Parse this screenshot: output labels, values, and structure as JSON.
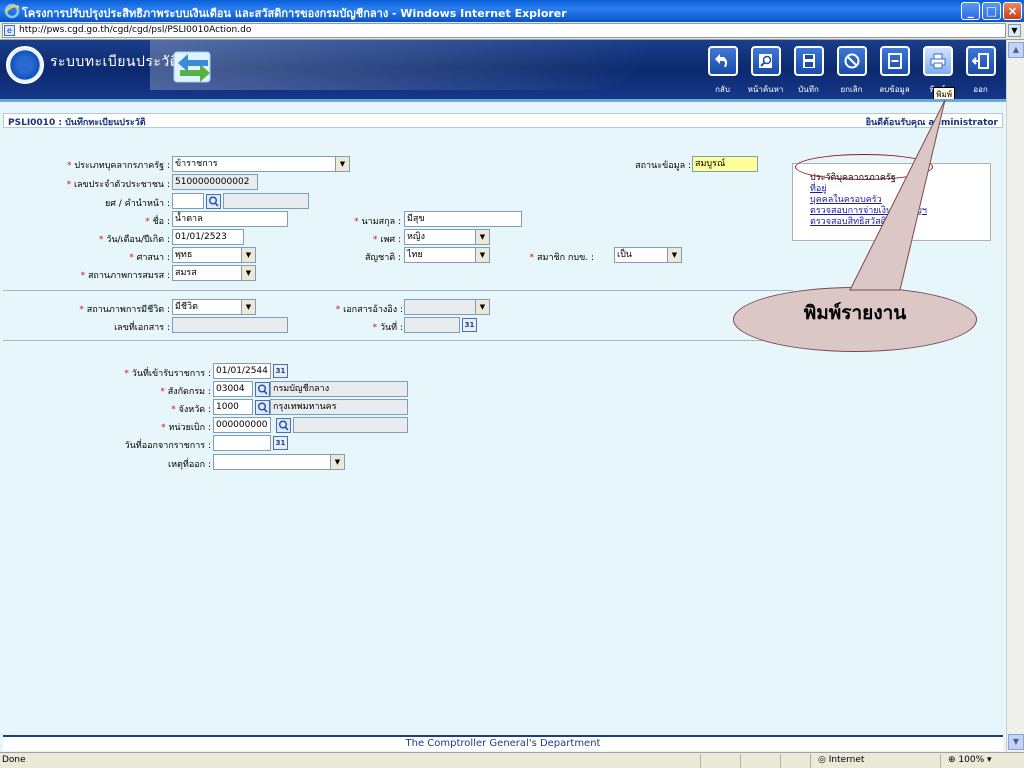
{
  "window": {
    "title": "โครงการปรับปรุงประสิทธิภาพระบบเงินเดือน และสวัสดิการของกรมบัญชีกลาง - Windows Internet Explorer",
    "url": "http://pws.cgd.go.th/cgd/cgd/psl/PSLI0010Action.do"
  },
  "app": {
    "title": "ระบบทะเบียนประวัติ",
    "toolbar": [
      {
        "id": "back",
        "label": "กลับ"
      },
      {
        "id": "search",
        "label": "หน้าค้นหา"
      },
      {
        "id": "save",
        "label": "บันทึก"
      },
      {
        "id": "cancel",
        "label": "ยกเลิก"
      },
      {
        "id": "delete",
        "label": "ลบข้อมูล"
      },
      {
        "id": "print",
        "label": "พิมพ์"
      },
      {
        "id": "exit",
        "label": "ออก"
      }
    ],
    "tooltip": "พิมพ์"
  },
  "section": {
    "code": "PSLI0010 : บันทึกทะเบียนประวัติ",
    "welcome": "ยินดีต้อนรับคุณ administrator"
  },
  "form": {
    "personnel_type_label": "ประเภทบุคลากรภาครัฐ :",
    "personnel_type": "ข้าราชการ",
    "citizen_id_label": "เลขประจำตัวประชาชน :",
    "citizen_id": "5100000000002",
    "rank_label": "ยศ / คำนำหน้า :",
    "rank": "",
    "first_name_label": "ชื่อ :",
    "first_name": "น้ำตาล",
    "last_name_label": "นามสกุล :",
    "last_name": "มีสุข",
    "birth_date_label": "วัน/เดือน/ปีเกิด :",
    "birth_date": "01/01/2523",
    "gender_label": "เพศ :",
    "gender": "หญิง",
    "religion_label": "ศาสนา :",
    "religion": "พุทธ",
    "nationality_label": "สัญชาติ :",
    "nationality": "ไทย",
    "gpf_member_label": "สมาชิก กบข. :",
    "gpf_member": "เป็น",
    "marital_label": "สถานภาพการสมรส :",
    "marital": "สมรส",
    "data_status_label": "สถานะข้อมูล :",
    "data_status": "สมบูรณ์",
    "life_status_label": "สถานภาพการมีชีวิต :",
    "life_status": "มีชีวิต",
    "ref_doc_label": "เอกสารอ้างอิง :",
    "ref_doc": "",
    "doc_no_label": "เลขที่เอกสาร :",
    "doc_no": "",
    "date_label": "วันที่ :",
    "date": "",
    "entry_date_label": "วันที่เข้ารับราชการ :",
    "entry_date": "01/01/2544",
    "dept_label": "สังกัดกรม :",
    "dept_code": "03004",
    "dept_name": "กรมบัญชีกลาง",
    "province_label": "จังหวัด :",
    "province_code": "1000",
    "province_name": "กรุงเทพมหานคร",
    "unit_label": "หน่วยเบิก :",
    "unit_code": "000000000",
    "unit_name": "",
    "exit_date_label": "วันที่ออกจากราชการ :",
    "exit_date": "",
    "exit_reason_label": "เหตุที่ออก :",
    "exit_reason": ""
  },
  "links": [
    "ประวัติบุคลากรภาครัฐ",
    "ที่อยู่",
    "บุคคลในครอบครัว",
    "ตรวจสอบการจ่ายเงินบำนาญฯ",
    "ตรวจสอบสิทธิสวัสดิการฯ"
  ],
  "annotation": "พิมพ์รายงาน",
  "footer": "The Comptroller General's Department",
  "status": {
    "left": "Done",
    "zone": "Internet",
    "zoom": "100%"
  },
  "colors": {
    "header_bg": "#0c2a6e",
    "content_bg": "#e7f6fb",
    "required": "#d0101a",
    "status_highlight": "#ffff99",
    "callout": "#dcc7c7"
  }
}
